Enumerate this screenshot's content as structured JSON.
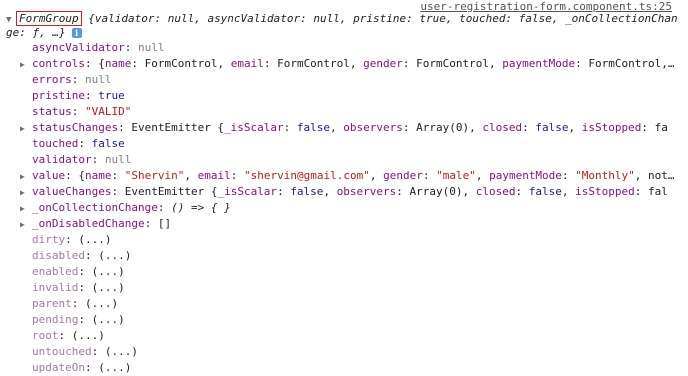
{
  "source_link": "user-registration-form.component.ts:25",
  "header": {
    "class_name": "FormGroup",
    "summary_line1": "{validator: null, asyncValidator: null, pristine: true, touched: false, _onCollectionChan",
    "summary_line2": "ge: ƒ, …}",
    "info_badge": "i"
  },
  "rows": [
    {
      "key": "asyncValidator",
      "sep": ": ",
      "value": "null",
      "kind": "null",
      "expandable": false,
      "getter": false
    },
    {
      "key": "controls",
      "sep": ": ",
      "value": "{name: FormControl, email: FormControl, gender: FormControl, paymentMode: FormControl,…",
      "kind": "plain",
      "expandable": true,
      "getter": false
    },
    {
      "key": "errors",
      "sep": ": ",
      "value": "null",
      "kind": "null",
      "expandable": false,
      "getter": false
    },
    {
      "key": "pristine",
      "sep": ": ",
      "value": "true",
      "kind": "bool",
      "expandable": false,
      "getter": false
    },
    {
      "key": "status",
      "sep": ": ",
      "value": "\"VALID\"",
      "kind": "string",
      "expandable": false,
      "getter": false
    },
    {
      "key": "statusChanges",
      "sep": ": ",
      "value": "EventEmitter {_isScalar: false, observers: Array(0), closed: false, isStopped: fa",
      "kind": "plain",
      "expandable": true,
      "getter": false
    },
    {
      "key": "touched",
      "sep": ": ",
      "value": "false",
      "kind": "bool",
      "expandable": false,
      "getter": false
    },
    {
      "key": "validator",
      "sep": ": ",
      "value": "null",
      "kind": "null",
      "expandable": false,
      "getter": false
    },
    {
      "key": "value",
      "sep": ": ",
      "value": "{name: \"Shervin\", email: \"shervin@gmail.com\", gender: \"male\", paymentMode: \"Monthly\", not…",
      "kind": "plain",
      "expandable": true,
      "getter": false
    },
    {
      "key": "valueChanges",
      "sep": ": ",
      "value": "EventEmitter {_isScalar: false, observers: Array(0), closed: false, isStopped: fal",
      "kind": "plain",
      "expandable": true,
      "getter": false
    },
    {
      "key": "_onCollectionChange",
      "sep": ": ",
      "value": "() => { }",
      "kind": "italic",
      "expandable": true,
      "getter": false
    },
    {
      "key": "_onDisabledChange",
      "sep": ": ",
      "value": "[]",
      "kind": "plain",
      "expandable": true,
      "getter": false
    },
    {
      "key": "dirty",
      "sep": ": ",
      "value": "(...)",
      "kind": "plain",
      "expandable": false,
      "getter": true
    },
    {
      "key": "disabled",
      "sep": ": ",
      "value": "(...)",
      "kind": "plain",
      "expandable": false,
      "getter": true
    },
    {
      "key": "enabled",
      "sep": ": ",
      "value": "(...)",
      "kind": "plain",
      "expandable": false,
      "getter": true
    },
    {
      "key": "invalid",
      "sep": ": ",
      "value": "(...)",
      "kind": "plain",
      "expandable": false,
      "getter": true
    },
    {
      "key": "parent",
      "sep": ": ",
      "value": "(...)",
      "kind": "plain",
      "expandable": false,
      "getter": true
    },
    {
      "key": "pending",
      "sep": ": ",
      "value": "(...)",
      "kind": "plain",
      "expandable": false,
      "getter": true
    },
    {
      "key": "root",
      "sep": ": ",
      "value": "(...)",
      "kind": "plain",
      "expandable": false,
      "getter": true
    },
    {
      "key": "untouched",
      "sep": ": ",
      "value": "(...)",
      "kind": "plain",
      "expandable": false,
      "getter": true
    },
    {
      "key": "updateOn",
      "sep": ": ",
      "value": "(...)",
      "kind": "plain",
      "expandable": false,
      "getter": true
    }
  ]
}
